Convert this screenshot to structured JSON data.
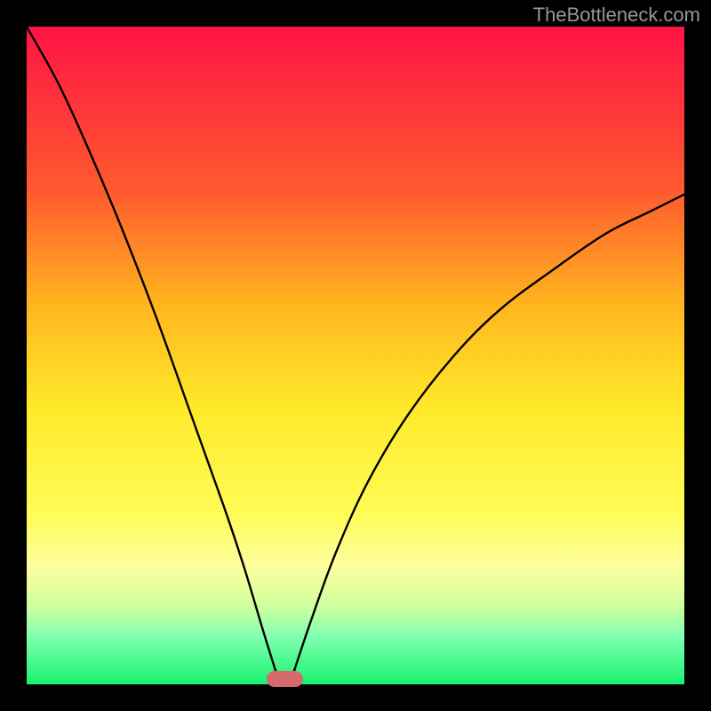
{
  "watermark": {
    "text": "TheBottleneck.com"
  },
  "gradient_colors": [
    "#ff1345",
    "#ff5a2e",
    "#ffb41e",
    "#ffe92a",
    "#fffc56",
    "#fdff9e",
    "#d0ff9e",
    "#7dffb0",
    "#17f36e"
  ],
  "chart_data": {
    "type": "line",
    "title": "",
    "xlabel": "",
    "ylabel": "",
    "xlim": [
      0,
      1
    ],
    "ylim": [
      0,
      1
    ],
    "optimum_x": 0.385,
    "marker": {
      "x_start": 0.365,
      "x_end": 0.42,
      "color": "#d66a6c"
    },
    "series": [
      {
        "name": "left-curve",
        "points": [
          {
            "x": 0.0,
            "y": 1.0
          },
          {
            "x": 0.05,
            "y": 0.91
          },
          {
            "x": 0.1,
            "y": 0.8
          },
          {
            "x": 0.15,
            "y": 0.68
          },
          {
            "x": 0.2,
            "y": 0.55
          },
          {
            "x": 0.25,
            "y": 0.41
          },
          {
            "x": 0.3,
            "y": 0.27
          },
          {
            "x": 0.33,
            "y": 0.18
          },
          {
            "x": 0.36,
            "y": 0.08
          },
          {
            "x": 0.385,
            "y": 0.0
          }
        ]
      },
      {
        "name": "right-curve",
        "points": [
          {
            "x": 0.4,
            "y": 0.0
          },
          {
            "x": 0.43,
            "y": 0.09
          },
          {
            "x": 0.47,
            "y": 0.2
          },
          {
            "x": 0.52,
            "y": 0.31
          },
          {
            "x": 0.58,
            "y": 0.41
          },
          {
            "x": 0.65,
            "y": 0.5
          },
          {
            "x": 0.72,
            "y": 0.57
          },
          {
            "x": 0.8,
            "y": 0.63
          },
          {
            "x": 0.88,
            "y": 0.685
          },
          {
            "x": 0.95,
            "y": 0.72
          },
          {
            "x": 1.0,
            "y": 0.745
          }
        ]
      }
    ]
  }
}
